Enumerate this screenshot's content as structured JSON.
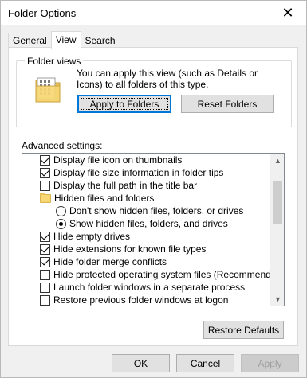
{
  "window": {
    "title": "Folder Options",
    "close_glyph": "✕"
  },
  "tabs": [
    {
      "label": "General",
      "active": false
    },
    {
      "label": "View",
      "active": true
    },
    {
      "label": "Search",
      "active": false
    }
  ],
  "folder_views": {
    "group_label": "Folder views",
    "description": "You can apply this view (such as Details or Icons) to all folders of this type.",
    "icon": "folder-views-icon",
    "apply_button": "Apply to Folders",
    "reset_button": "Reset Folders"
  },
  "advanced": {
    "label": "Advanced settings:",
    "items": [
      {
        "type": "checkbox",
        "label": "Display file icon on thumbnails",
        "checked": true
      },
      {
        "type": "checkbox",
        "label": "Display file size information in folder tips",
        "checked": true
      },
      {
        "type": "checkbox",
        "label": "Display the full path in the title bar",
        "checked": false
      },
      {
        "type": "folder",
        "label": "Hidden files and folders",
        "icon": "folder-icon"
      },
      {
        "type": "radio",
        "label": "Don't show hidden files, folders, or drives",
        "checked": false
      },
      {
        "type": "radio",
        "label": "Show hidden files, folders, and drives",
        "checked": true
      },
      {
        "type": "checkbox",
        "label": "Hide empty drives",
        "checked": true
      },
      {
        "type": "checkbox",
        "label": "Hide extensions for known file types",
        "checked": true
      },
      {
        "type": "checkbox",
        "label": "Hide folder merge conflicts",
        "checked": true
      },
      {
        "type": "checkbox",
        "label": "Hide protected operating system files (Recommended)",
        "checked": false
      },
      {
        "type": "checkbox",
        "label": "Launch folder windows in a separate process",
        "checked": false
      },
      {
        "type": "checkbox",
        "label": "Restore previous folder windows at logon",
        "checked": false
      }
    ],
    "scroll_up_glyph": "▲",
    "scroll_down_glyph": "▼"
  },
  "restore_defaults_button": "Restore Defaults",
  "footer": {
    "ok": "OK",
    "cancel": "Cancel",
    "apply": "Apply"
  },
  "colors": {
    "dialog_bg": "#f0f0f0",
    "focus_border": "#0078d7",
    "folder_yellow": "#f7d674"
  }
}
